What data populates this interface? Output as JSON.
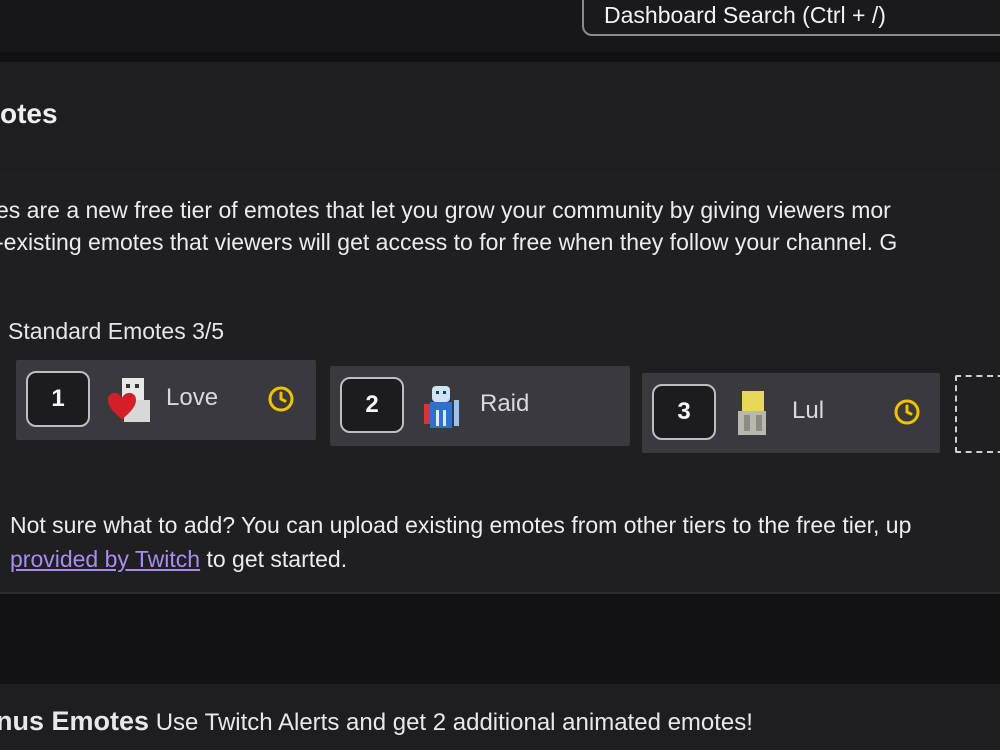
{
  "search": {
    "label": "Dashboard Search (Ctrl + /)"
  },
  "section": {
    "title": "otes"
  },
  "description": {
    "line1": "es are a new free tier of emotes that let you grow your community by giving viewers mor",
    "line2": "-existing emotes that viewers will get access to for free when they follow your channel. G"
  },
  "standard": {
    "label": "Standard Emotes 3/5",
    "slots": [
      {
        "number": "1",
        "name": "Love",
        "emote_icon": "love-emote-icon",
        "pending": true
      },
      {
        "number": "2",
        "name": "Raid",
        "emote_icon": "raid-emote-icon",
        "pending": false
      },
      {
        "number": "3",
        "name": "Lul",
        "emote_icon": "lul-emote-icon",
        "pending": true
      }
    ]
  },
  "hint": {
    "line1": "Not sure what to add? You can upload existing emotes from other tiers to the free tier, up",
    "link": "provided by Twitch",
    "line2_rest": " to get started."
  },
  "bonus": {
    "title": "nus Emotes",
    "text": " Use Twitch Alerts and get 2 additional animated emotes!"
  },
  "colors": {
    "accent_link": "#a98cf0",
    "pending_clock": "#f2c200",
    "slot_bg": "#3a3a3e",
    "panel_bg": "#1f1f22"
  }
}
